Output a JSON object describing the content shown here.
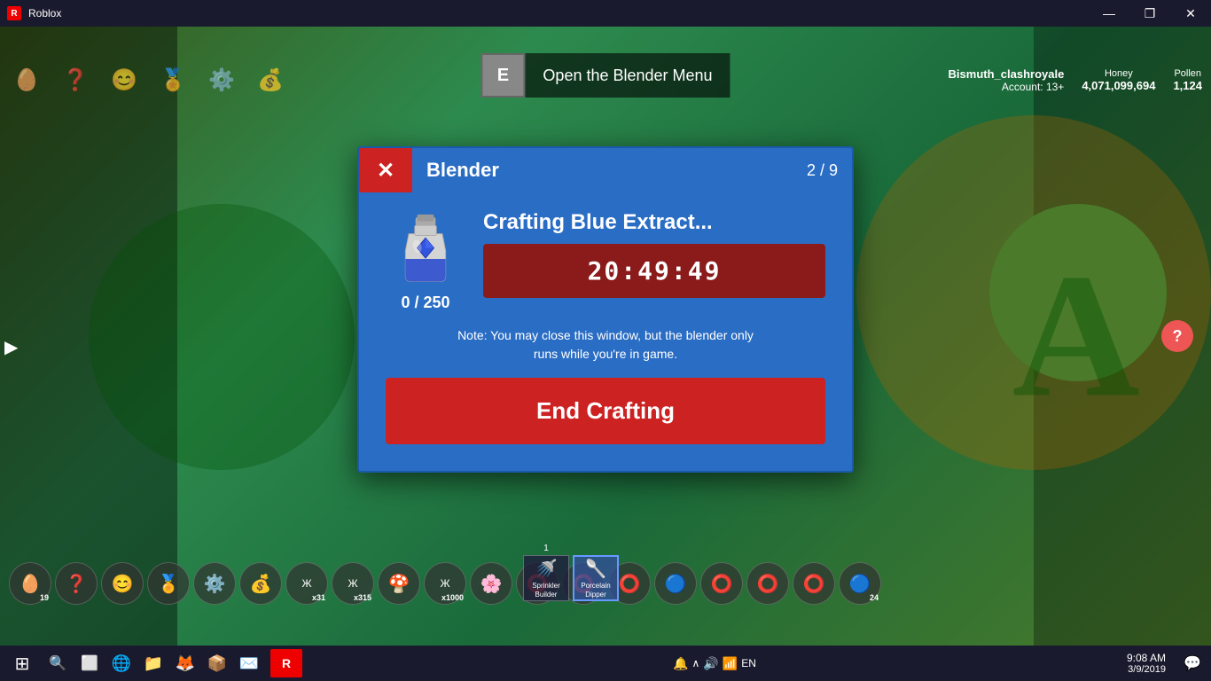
{
  "titlebar": {
    "title": "Roblox",
    "min_label": "—",
    "max_label": "❐",
    "close_label": "✕"
  },
  "hud": {
    "user_name": "Bismuth_clashroyale",
    "account_level": "Account: 13+",
    "honey_label": "Honey",
    "honey_value": "4,071,099,694",
    "pollen_label": "Pollen",
    "pollen_value": "1,124"
  },
  "open_blender": {
    "key": "E",
    "label": "Open the Blender Menu"
  },
  "modal": {
    "title": "Blender",
    "page": "2 / 9",
    "close_label": "✕",
    "crafting_name": "Crafting Blue Extract...",
    "item_count": "0 / 250",
    "timer": "20:49:49",
    "note": "Note: You may close this window, but the blender only\nruns while you're in game.",
    "end_button": "End Crafting"
  },
  "inventory": {
    "items": [
      {
        "icon": "🥚",
        "count": "19"
      },
      {
        "icon": "❓",
        "count": ""
      },
      {
        "icon": "😊",
        "count": ""
      },
      {
        "icon": "🏅",
        "count": ""
      },
      {
        "icon": "⚙️",
        "count": ""
      },
      {
        "icon": "💰",
        "count": ""
      },
      {
        "icon": "Ж",
        "count": "x31"
      },
      {
        "icon": "Ж",
        "count": "x315"
      },
      {
        "icon": "🍄",
        "count": ""
      },
      {
        "icon": "Ж",
        "count": "x1000"
      },
      {
        "icon": "🌸",
        "count": ""
      },
      {
        "icon": "⭕",
        "count": ""
      },
      {
        "icon": "⭕",
        "count": ""
      },
      {
        "icon": "⭕",
        "count": ""
      },
      {
        "icon": "🔵",
        "count": ""
      },
      {
        "icon": "⭕",
        "count": ""
      },
      {
        "icon": "⭕",
        "count": ""
      },
      {
        "icon": "⭕",
        "count": ""
      },
      {
        "icon": "🔵",
        "count": "24"
      }
    ]
  },
  "special_items": [
    {
      "count": "1",
      "name": "Sprinkler\nBuilder",
      "icon": "🚿",
      "highlighted": false
    },
    {
      "count": "",
      "name": "Porcelain\nDipper",
      "icon": "🥄",
      "highlighted": true
    }
  ],
  "taskbar": {
    "start_icon": "⊞",
    "icons": [
      "🔍",
      "🗂️",
      "🌐",
      "📁",
      "🛡️",
      "📦",
      "✉️"
    ],
    "roblox_label": "R",
    "sys_icons": [
      "🔔",
      "^",
      "🔊",
      "📶"
    ],
    "time": "9:08 AM",
    "date": "3/9/2019",
    "chat_icon": "💬"
  },
  "colors": {
    "modal_bg": "#2a6dc4",
    "modal_header_red": "#cc2222",
    "timer_bg": "#8b1a1a",
    "end_btn_bg": "#cc2222",
    "game_bg": "#2d4a1e"
  }
}
